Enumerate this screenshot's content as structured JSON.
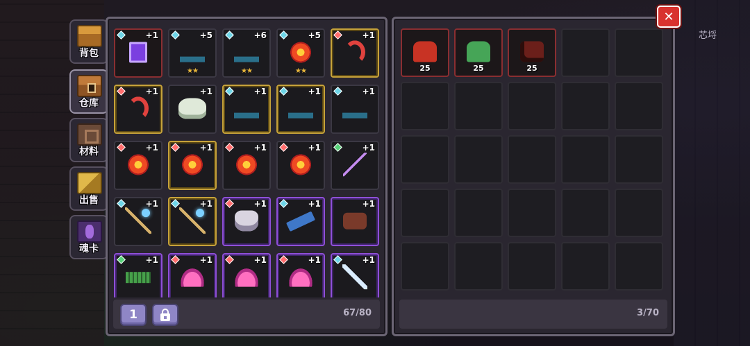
{
  "corner_label": "芯埒",
  "side_tabs": [
    {
      "label": "背包",
      "icon": "backpack-icon",
      "icon_class": "ic-backpack",
      "active": false
    },
    {
      "label": "仓库",
      "icon": "warehouse-chest-icon",
      "icon_class": "ic-warehouse",
      "active": true
    },
    {
      "label": "材料",
      "icon": "material-icon",
      "icon_class": "ic-material",
      "active": false
    },
    {
      "label": "出售",
      "icon": "sell-gold-icon",
      "icon_class": "ic-sell",
      "active": false
    },
    {
      "label": "魂卡",
      "icon": "soul-card-icon",
      "icon_class": "ic-soulcard",
      "active": false
    }
  ],
  "warehouse": {
    "count": "67/80",
    "page_button": "1",
    "lock_button_icon": "lock-icon",
    "items": [
      {
        "name": "purple-spellbook",
        "art": "art-purple-book",
        "rarity": "r-red",
        "gem": "#6fd6e8",
        "plus": "+1",
        "stars": ""
      },
      {
        "name": "blue-spike-helm",
        "art": "art-blue-spikes",
        "rarity": "r-dark",
        "gem": "#6fd6e8",
        "plus": "+5",
        "stars": "★★"
      },
      {
        "name": "blue-spike-helm",
        "art": "art-blue-spikes",
        "rarity": "r-dark",
        "gem": "#6fd6e8",
        "plus": "+6",
        "stars": "★★"
      },
      {
        "name": "flame-sun-orb",
        "art": "art-sun",
        "rarity": "r-dark",
        "gem": "#6fd6e8",
        "plus": "+5",
        "stars": "★★"
      },
      {
        "name": "red-hook",
        "art": "art-hook",
        "rarity": "r-gold",
        "gem": "#ff6e6e",
        "plus": "+1",
        "stars": ""
      },
      {
        "name": "red-hook",
        "art": "art-hook",
        "rarity": "r-gold",
        "gem": "#ff6e6e",
        "plus": "+1",
        "stars": ""
      },
      {
        "name": "ghost-cloud",
        "art": "art-ghost",
        "rarity": "r-dark",
        "gem": "",
        "plus": "+1",
        "stars": ""
      },
      {
        "name": "blue-spike-helm",
        "art": "art-blue-spikes",
        "rarity": "r-gold",
        "gem": "#6fd6e8",
        "plus": "+1",
        "stars": ""
      },
      {
        "name": "blue-spike-helm",
        "art": "art-blue-spikes",
        "rarity": "r-gold",
        "gem": "#6fd6e8",
        "plus": "+1",
        "stars": ""
      },
      {
        "name": "blue-spike-helm",
        "art": "art-blue-spikes",
        "rarity": "r-dark",
        "gem": "#6fd6e8",
        "plus": "+1",
        "stars": ""
      },
      {
        "name": "flame-sun-orb",
        "art": "art-sun",
        "rarity": "r-dark",
        "gem": "#ff6e6e",
        "plus": "+1",
        "stars": ""
      },
      {
        "name": "flame-sun-orb",
        "art": "art-sun",
        "rarity": "r-gold",
        "gem": "#ff6e6e",
        "plus": "+1",
        "stars": ""
      },
      {
        "name": "flame-sun-orb",
        "art": "art-sun",
        "rarity": "r-dark",
        "gem": "#ff6e6e",
        "plus": "+1",
        "stars": ""
      },
      {
        "name": "flame-sun-orb",
        "art": "art-sun",
        "rarity": "r-dark",
        "gem": "#ff6e6e",
        "plus": "+1",
        "stars": ""
      },
      {
        "name": "purple-scythe",
        "art": "art-scythe",
        "rarity": "r-dark",
        "gem": "#58d27a",
        "plus": "+1",
        "stars": ""
      },
      {
        "name": "ice-staff",
        "art": "art-staff",
        "rarity": "r-dark",
        "gem": "#6fd6e8",
        "plus": "+1",
        "stars": ""
      },
      {
        "name": "ice-staff",
        "art": "art-staff",
        "rarity": "r-gold",
        "gem": "#6fd6e8",
        "plus": "+1",
        "stars": ""
      },
      {
        "name": "silver-helmet",
        "art": "art-helmet",
        "rarity": "r-purple",
        "gem": "#ff6e6e",
        "plus": "+1",
        "stars": ""
      },
      {
        "name": "blue-rifle",
        "art": "art-rifle",
        "rarity": "r-purple",
        "gem": "#6fd6e8",
        "plus": "+1",
        "stars": ""
      },
      {
        "name": "brown-gauntlet",
        "art": "art-glove",
        "rarity": "r-purple",
        "gem": "",
        "plus": "+1",
        "stars": ""
      },
      {
        "name": "green-minigun",
        "art": "art-minigun",
        "rarity": "r-purple",
        "gem": "#58d27a",
        "plus": "+1",
        "stars": ""
      },
      {
        "name": "pink-lotus",
        "art": "art-lotus",
        "rarity": "r-purple",
        "gem": "#ff6e6e",
        "plus": "+1",
        "stars": ""
      },
      {
        "name": "pink-lotus",
        "art": "art-lotus",
        "rarity": "r-purple",
        "gem": "#ff6e6e",
        "plus": "+1",
        "stars": ""
      },
      {
        "name": "pink-lotus",
        "art": "art-lotus",
        "rarity": "r-purple",
        "gem": "#ff6e6e",
        "plus": "+1",
        "stars": ""
      },
      {
        "name": "ice-sword",
        "art": "art-sword",
        "rarity": "r-purple",
        "gem": "#6fd6e8",
        "plus": "+1",
        "stars": ""
      }
    ]
  },
  "backpack": {
    "count": "3/70",
    "items": [
      {
        "name": "red-armor",
        "art": "art-red-armor",
        "qty": "25"
      },
      {
        "name": "green-armor",
        "art": "art-green-armor",
        "qty": "25"
      },
      {
        "name": "dark-flame-armor",
        "art": "art-dark-armor",
        "qty": "25"
      }
    ],
    "total_slots": 25
  },
  "close_label": "✕"
}
